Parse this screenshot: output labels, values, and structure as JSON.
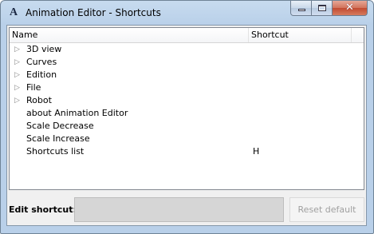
{
  "window": {
    "title": "Animation Editor - Shortcuts",
    "app_icon_glyph": "A",
    "icon": "app-logo-icon",
    "caption": {
      "minimize_icon": "minimize-icon",
      "maximize_icon": "maximize-icon",
      "close_glyph": "✕",
      "close_icon": "close-icon"
    }
  },
  "tree": {
    "columns": [
      "Name",
      "Shortcut"
    ],
    "rows": [
      {
        "expander": "▷",
        "label": "3D view",
        "shortcut": ""
      },
      {
        "expander": "▷",
        "label": "Curves",
        "shortcut": ""
      },
      {
        "expander": "▷",
        "label": "Edition",
        "shortcut": ""
      },
      {
        "expander": "▷",
        "label": "File",
        "shortcut": ""
      },
      {
        "expander": "▷",
        "label": "Robot",
        "shortcut": ""
      },
      {
        "expander": "",
        "label": "about Animation Editor",
        "shortcut": ""
      },
      {
        "expander": "",
        "label": "Scale Decrease",
        "shortcut": ""
      },
      {
        "expander": "",
        "label": "Scale Increase",
        "shortcut": ""
      },
      {
        "expander": "",
        "label": "Shortcuts list",
        "shortcut": "H"
      }
    ]
  },
  "edit": {
    "label": "Edit shortcut:",
    "value": "",
    "reset_label": "Reset default"
  }
}
